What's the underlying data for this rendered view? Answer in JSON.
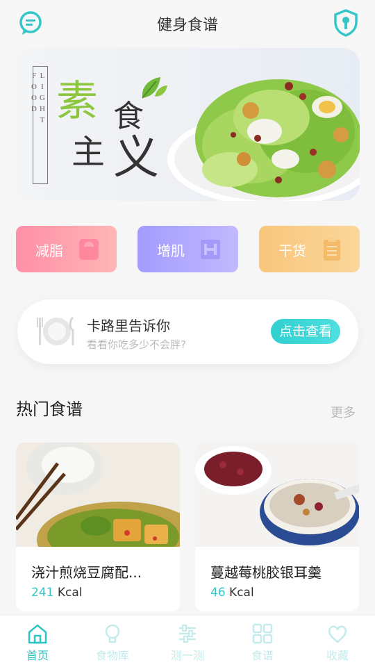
{
  "header": {
    "title": "健身食谱",
    "left_icon": "chat-icon",
    "right_icon": "shield-icon"
  },
  "banner": {
    "vertical_text": "LIGHT FOOD",
    "c1": "素",
    "c2": "食",
    "c3": "主",
    "c4": "义"
  },
  "categories": [
    {
      "label": "减脂",
      "icon": "scale-icon"
    },
    {
      "label": "增肌",
      "icon": "dumbbell-icon"
    },
    {
      "label": "干货",
      "icon": "clipboard-icon"
    }
  ],
  "calorie": {
    "title": "卡路里告诉你",
    "subtitle": "看看你吃多少不会胖?",
    "button": "点击查看"
  },
  "section": {
    "title": "热门食谱",
    "more": "更多"
  },
  "recipes": [
    {
      "name": "浇汁煎烧豆腐配...",
      "kcal": "241",
      "unit": "Kcal"
    },
    {
      "name": "蔓越莓桃胶银耳羹",
      "kcal": "46",
      "unit": "Kcal"
    }
  ],
  "tabs": [
    {
      "label": "首页",
      "active": true
    },
    {
      "label": "食物库",
      "active": false
    },
    {
      "label": "测一测",
      "active": false
    },
    {
      "label": "食谱",
      "active": false
    },
    {
      "label": "收藏",
      "active": false
    }
  ],
  "colors": {
    "accent": "#33c7c9",
    "cat_fat": "#ff8fa7",
    "cat_muscle": "#a49bff",
    "cat_dry": "#f8c57b"
  }
}
